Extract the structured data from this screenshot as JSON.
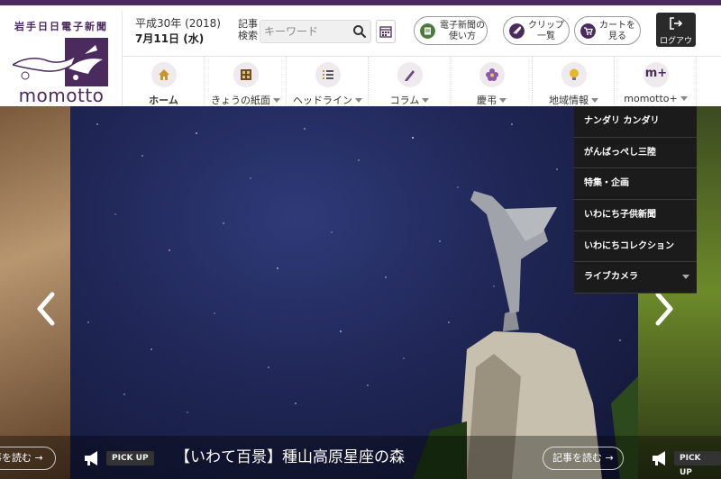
{
  "site": {
    "paper_name": "岩手日日電子新聞",
    "wordmark": "momotto",
    "brand_color": "#4b2a5e"
  },
  "date": {
    "line1": "平成30年 (2018)",
    "line2": "7月11日 (水)"
  },
  "search": {
    "label": "記事検索",
    "placeholder": "キーワード"
  },
  "header_buttons": {
    "denshi": "電子新聞の使い方",
    "clip": "クリップ一覧",
    "cart": "カートを見る",
    "logout": "ログアウト"
  },
  "nav": {
    "items": [
      {
        "label": "ホーム",
        "icon": "house-icon"
      },
      {
        "label": "きょうの紙面",
        "icon": "newspaper-icon"
      },
      {
        "label": "ヘッドライン",
        "icon": "list-icon"
      },
      {
        "label": "コラム",
        "icon": "pen-icon"
      },
      {
        "label": "慶弔",
        "icon": "flower-icon"
      },
      {
        "label": "地域情報",
        "icon": "lightbulb-icon"
      },
      {
        "label": "momotto+",
        "icon_text": "m+"
      }
    ]
  },
  "dropdown": {
    "items": [
      "ナンダリ カンダリ",
      "がんばっぺし三陸",
      "特集・企画",
      "いわにち子供新聞",
      "いわにちコレクション",
      "ライブカメラ"
    ]
  },
  "hero": {
    "read_more_left": "事を読む",
    "read_more": "記事を読む",
    "pickup_badge": "PICK UP",
    "pickup_title": "【いわて百景】種山高原星座の森"
  }
}
